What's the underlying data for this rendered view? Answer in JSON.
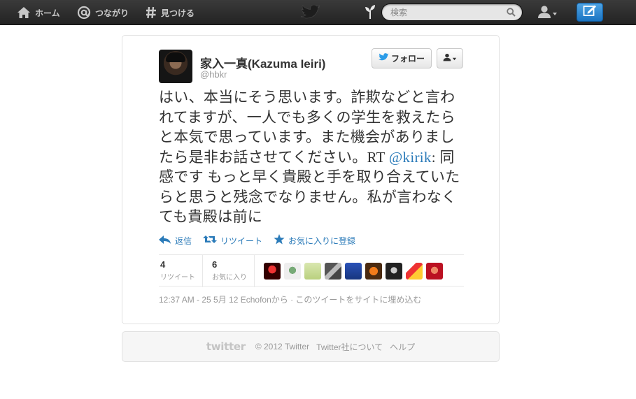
{
  "topbar": {
    "home_label": "ホーム",
    "connect_label": "つながり",
    "discover_label": "見つける",
    "search_placeholder": "検索"
  },
  "tweet": {
    "author_name": "家入一真(Kazuma Ieiri)",
    "author_handle": "@hbkr",
    "follow_label": "フォロー",
    "text_before_mention": "はい、本当にそう思います。詐欺などと言われてますが、一人でも多くの学生を救えたらと本気で思っています。また機会がありましたら是非お話させてください。RT ",
    "mention": "@kirik",
    "text_after_mention": ": 同感です もっと早く貴殿と手を取り合えていたらと思うと残念でなりません。私が言わなくても貴殿は前に",
    "actions": {
      "reply": "返信",
      "retweet": "リツイート",
      "favorite": "お気に入りに登録"
    },
    "stats": {
      "retweet_count": "4",
      "retweet_label": "リツイート",
      "favorite_count": "6",
      "favorite_label": "お気に入り"
    },
    "meta": "12:37 AM - 25 5月 12 Echofonから · このツイートをサイトに埋め込む"
  },
  "footer": {
    "logo": "twitter",
    "copyright": "© 2012 Twitter",
    "about": "Twitter社について",
    "help": "ヘルプ"
  },
  "colors": {
    "link": "#2b7bb9",
    "compose": "#1b74c2",
    "topbar": "#2d2d2d"
  }
}
